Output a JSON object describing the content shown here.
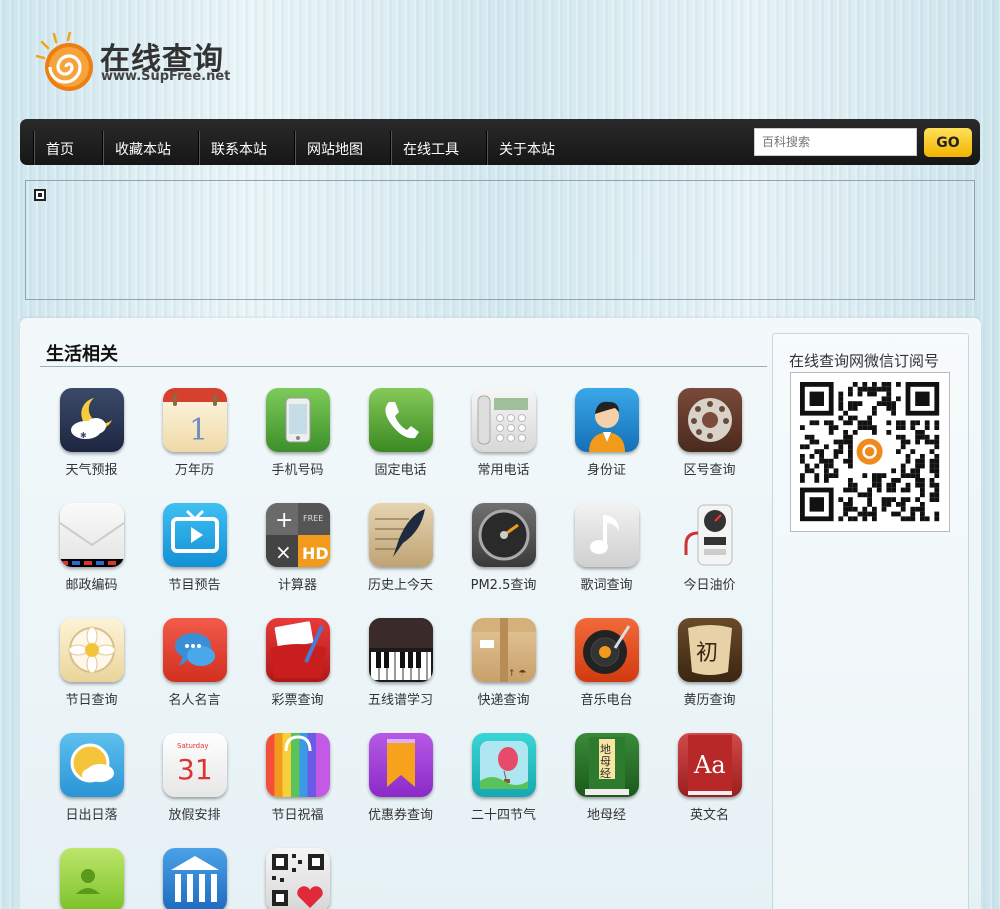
{
  "logo": {
    "title": "在线查询",
    "url": "www.SupFree.net"
  },
  "nav": {
    "items": [
      "首页",
      "收藏本站",
      "联系本站",
      "网站地图",
      "在线工具",
      "关于本站"
    ],
    "search_placeholder": "百科搜索",
    "go_label": "GO"
  },
  "section": {
    "title": "生活相关"
  },
  "apps": [
    {
      "label": "天气预报",
      "icon": "weather-icon"
    },
    {
      "label": "万年历",
      "icon": "calendar-icon"
    },
    {
      "label": "手机号码",
      "icon": "mobile-phone-icon"
    },
    {
      "label": "固定电话",
      "icon": "landline-phone-icon"
    },
    {
      "label": "常用电话",
      "icon": "desk-phone-icon"
    },
    {
      "label": "身份证",
      "icon": "id-card-icon"
    },
    {
      "label": "区号查询",
      "icon": "rotary-phone-icon"
    },
    {
      "label": "邮政编码",
      "icon": "envelope-icon"
    },
    {
      "label": "节目预告",
      "icon": "tv-icon"
    },
    {
      "label": "计算器",
      "icon": "calculator-icon"
    },
    {
      "label": "历史上今天",
      "icon": "quill-icon"
    },
    {
      "label": "PM2.5查询",
      "icon": "gauge-icon"
    },
    {
      "label": "歌词查询",
      "icon": "music-note-icon"
    },
    {
      "label": "今日油价",
      "icon": "gas-pump-icon"
    },
    {
      "label": "节日查询",
      "icon": "flower-icon"
    },
    {
      "label": "名人名言",
      "icon": "chat-bubble-icon"
    },
    {
      "label": "彩票查询",
      "icon": "lottery-icon"
    },
    {
      "label": "五线谱学习",
      "icon": "piano-icon"
    },
    {
      "label": "快递查询",
      "icon": "parcel-icon"
    },
    {
      "label": "音乐电台",
      "icon": "turntable-icon"
    },
    {
      "label": "黄历查询",
      "icon": "almanac-scroll-icon"
    },
    {
      "label": "日出日落",
      "icon": "sun-cloud-icon"
    },
    {
      "label": "放假安排",
      "icon": "date-31-icon"
    },
    {
      "label": "节日祝福",
      "icon": "gift-bag-icon"
    },
    {
      "label": "优惠券查询",
      "icon": "coupon-icon"
    },
    {
      "label": "二十四节气",
      "icon": "balloon-icon"
    },
    {
      "label": "地母经",
      "icon": "book-icon"
    },
    {
      "label": "英文名",
      "icon": "dictionary-icon"
    },
    {
      "label": "",
      "icon": "contact-card-icon"
    },
    {
      "label": "",
      "icon": "bank-icon"
    },
    {
      "label": "",
      "icon": "qr-heart-icon"
    }
  ],
  "sidebar": {
    "title": "在线查询网微信订阅号"
  },
  "colors": {
    "nav_bg": "#1e1e1e",
    "go_button": "#f8c820",
    "logo_orange": "#f08a1c"
  }
}
